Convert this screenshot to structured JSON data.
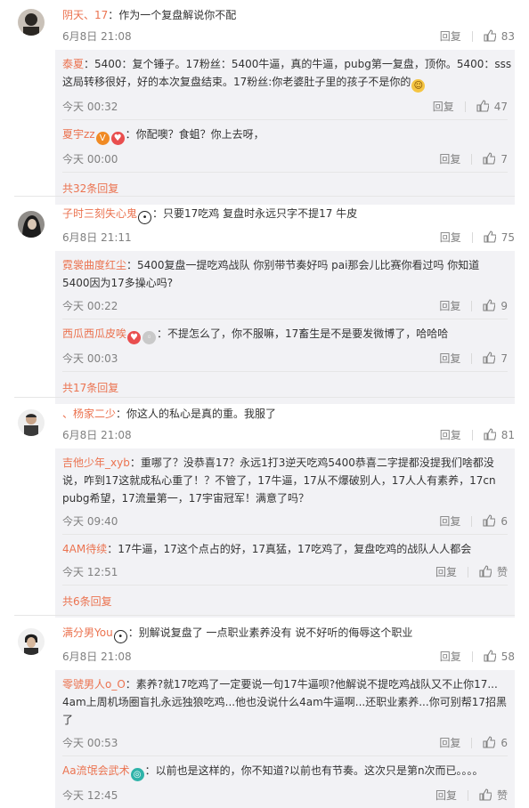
{
  "labels": {
    "reply": "回复",
    "like": "赞"
  },
  "threads": [
    {
      "user": "阴天、17",
      "text": "作为一个复盘解说你不配",
      "time": "6月8日 21:08",
      "likes": "83",
      "replies": [
        {
          "user": "泰夏",
          "text1": "：5400：复个锤子。17粉丝：5400牛逼，真的牛逼，pubg第一复盘，顶你。5400：sss",
          "text2": "这局转移很好，好的本次复盘结束。17粉丝:你老婆肚子里的孩子不是你的",
          "time": "今天 00:32",
          "likes": "47"
        },
        {
          "user": "夏宇zz",
          "text1": "：你配噢？食蛆？你上去呀，",
          "time": "今天 00:00",
          "likes": "7"
        }
      ],
      "more": "共32条回复"
    },
    {
      "user": "子时三刻失心鬼",
      "text": "只要17吃鸡  复盘时永远只字不提17  牛皮",
      "time": "6月8日 21:11",
      "likes": "75",
      "replies": [
        {
          "user": "霓裳曲度红尘",
          "text1": "：5400复盘一提吃鸡战队 你别带节奏好吗 pai那会儿比赛你看过吗 你知道",
          "text2": "5400因为17多操心吗?",
          "time": "今天 00:22",
          "likes": "9"
        },
        {
          "user": "西瓜西瓜皮唉",
          "text1": "：不提怎么了，你不服嘛，17畜生是不是要发微博了，哈哈哈",
          "time": "今天 00:03",
          "likes": "7"
        }
      ],
      "more": "共17条回复"
    },
    {
      "user": "、杨家二少",
      "text": "你这人的私心是真的重。我服了",
      "time": "6月8日 21:08",
      "likes": "81",
      "replies": [
        {
          "user": "吉他少年_xyb",
          "text1": "：重哪了？没恭喜17？永远1打3逆天吃鸡5400恭喜二字提都没提我们啥都没",
          "text2": "说，咋到17这就成私心重了！？不管了，17牛逼，17从不爆破别人，17人人有素养，17cn",
          "text3": "pubg希望，17流量第一，17宇宙冠军！满意了吗？",
          "time": "今天 09:40",
          "likes": "6"
        },
        {
          "user": "4AM待续",
          "text1": "：17牛逼，17这个点占的好，17真猛，17吃鸡了，复盘吃鸡的战队人人都会",
          "time": "今天 12:51",
          "likes": "赞"
        }
      ],
      "more": "共6条回复"
    },
    {
      "user": "满分男You",
      "text": "别解说复盘了 一点职业素养没有 说不好听的侮辱这个职业",
      "time": "6月8日 21:08",
      "likes": "58",
      "replies": [
        {
          "user": "零號男人o_O",
          "text1": "：素养?就17吃鸡了一定要说一句17牛逼呗?他解说不提吃鸡战队又不止你17...",
          "text2": "4am上周机场圈盲扎永远独狼吃鸡...他也没说什么4am牛逼啊...还职业素养...你可别帮17招黑",
          "text3": "了",
          "time": "今天 00:53",
          "likes": "6"
        },
        {
          "user": "Aa流氓会武术",
          "text1": "：以前也是这样的，你不知道?以前也有节奏。这次只是第n次而已。。。。",
          "time": "今天 12:45",
          "likes": "赞"
        }
      ]
    }
  ]
}
